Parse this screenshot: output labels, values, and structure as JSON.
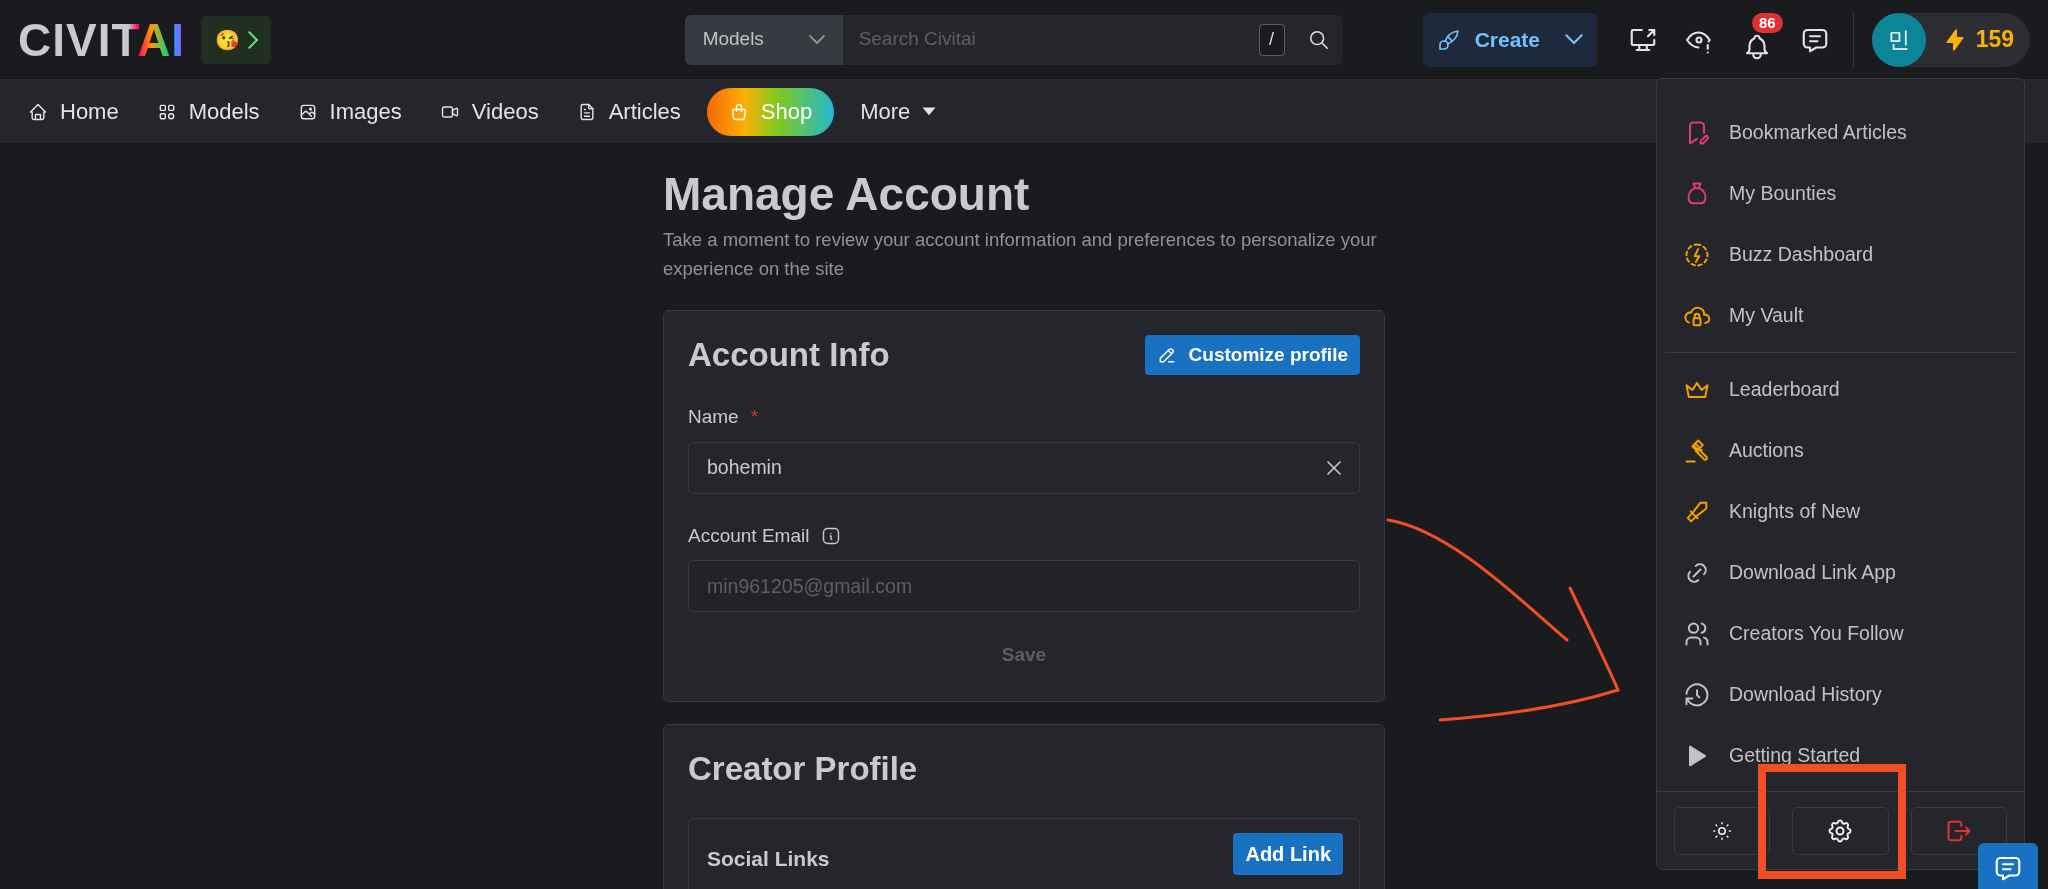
{
  "header": {
    "logo": "CIVITAI",
    "emoji_button": "😘",
    "search": {
      "scope": "Models",
      "placeholder": "Search Civitai",
      "shortcut": "/"
    },
    "create_button": "Create",
    "notification_count": "86",
    "avatar": "민",
    "buzz": "159"
  },
  "nav": [
    {
      "label": "Home",
      "kind": "link"
    },
    {
      "label": "Models",
      "kind": "link"
    },
    {
      "label": "Images",
      "kind": "link"
    },
    {
      "label": "Videos",
      "kind": "link"
    },
    {
      "label": "Articles",
      "kind": "link"
    },
    {
      "label": "Shop",
      "kind": "shop"
    },
    {
      "label": "More",
      "kind": "menu"
    }
  ],
  "page": {
    "title": "Manage Account",
    "subtitle": "Take a moment to review your account information and preferences to personalize your experience on the site",
    "account_card": {
      "title": "Account Info",
      "customize_button": "Customize profile",
      "required_mark": "*",
      "fields": [
        {
          "label": "Name",
          "required": true,
          "info": false,
          "value": "bohemin",
          "disabled": false,
          "clearable": true
        },
        {
          "label": "Account Email",
          "required": false,
          "info": true,
          "value": "min961205@gmail.com",
          "disabled": true,
          "clearable": false
        }
      ],
      "save_button": "Save",
      "save_disabled": true
    },
    "creator_card": {
      "title": "Creator Profile",
      "social_links": {
        "title": "Social Links",
        "button": "Add Link"
      }
    }
  },
  "user_menu": {
    "groups": [
      [
        {
          "label": "Bookmarked Articles",
          "color": "#e03d6e"
        },
        {
          "label": "My Bounties",
          "color": "#e03d6e"
        },
        {
          "label": "Buzz Dashboard",
          "color": "#f59f00"
        },
        {
          "label": "My Vault",
          "color": "#f59f00"
        }
      ],
      [
        {
          "label": "Leaderboard",
          "color": "#f59f00"
        },
        {
          "label": "Auctions",
          "color": "#f59f00"
        },
        {
          "label": "Knights of New",
          "color": "#f59f00"
        },
        {
          "label": "Download Link App",
          "color": "#c1c2c5"
        },
        {
          "label": "Creators You Follow",
          "color": "#c1c2c5"
        },
        {
          "label": "Download History",
          "color": "#c1c2c5"
        },
        {
          "label": "Getting Started",
          "color": "#c1c2c5"
        }
      ]
    ]
  },
  "annotations": {
    "arrow": true,
    "highlight_box": true
  }
}
